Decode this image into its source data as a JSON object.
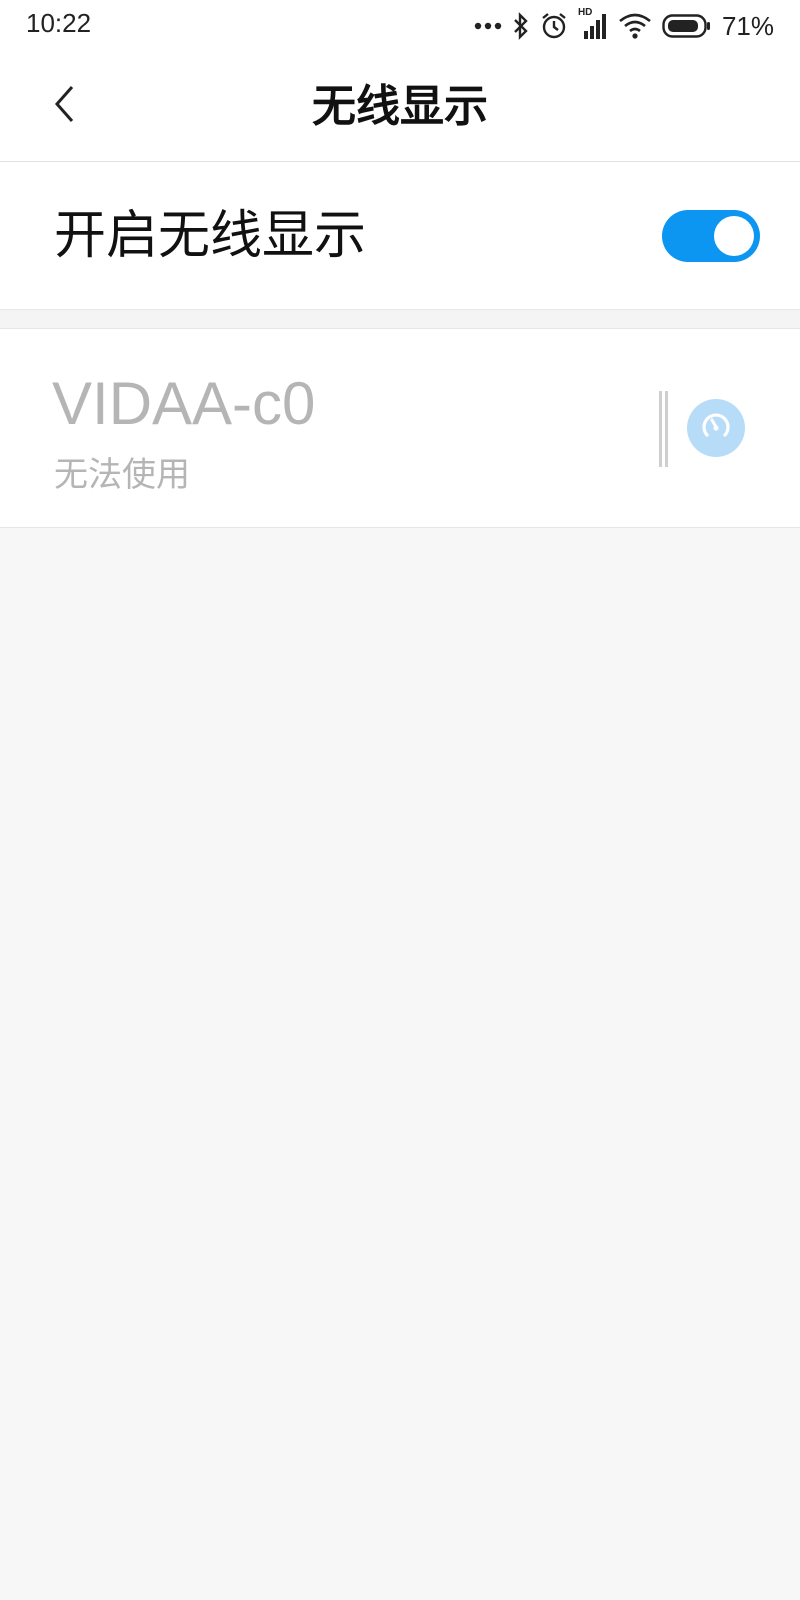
{
  "status_bar": {
    "time": "10:22",
    "battery_percent": "71%",
    "hd_badge": "HD",
    "icons": [
      "more-dots-icon",
      "bluetooth-icon",
      "alarm-icon",
      "signal-icon",
      "wifi-icon",
      "battery-icon"
    ]
  },
  "header": {
    "title": "无线显示",
    "back_icon": "chevron-left-icon"
  },
  "toggle": {
    "label": "开启无线显示",
    "on": true,
    "on_color": "#0d95f2"
  },
  "devices": [
    {
      "name": "VIDAA-c0",
      "status": "无法使用",
      "action_icon": "speedometer-icon",
      "action_color": "#b7dcf8"
    }
  ]
}
